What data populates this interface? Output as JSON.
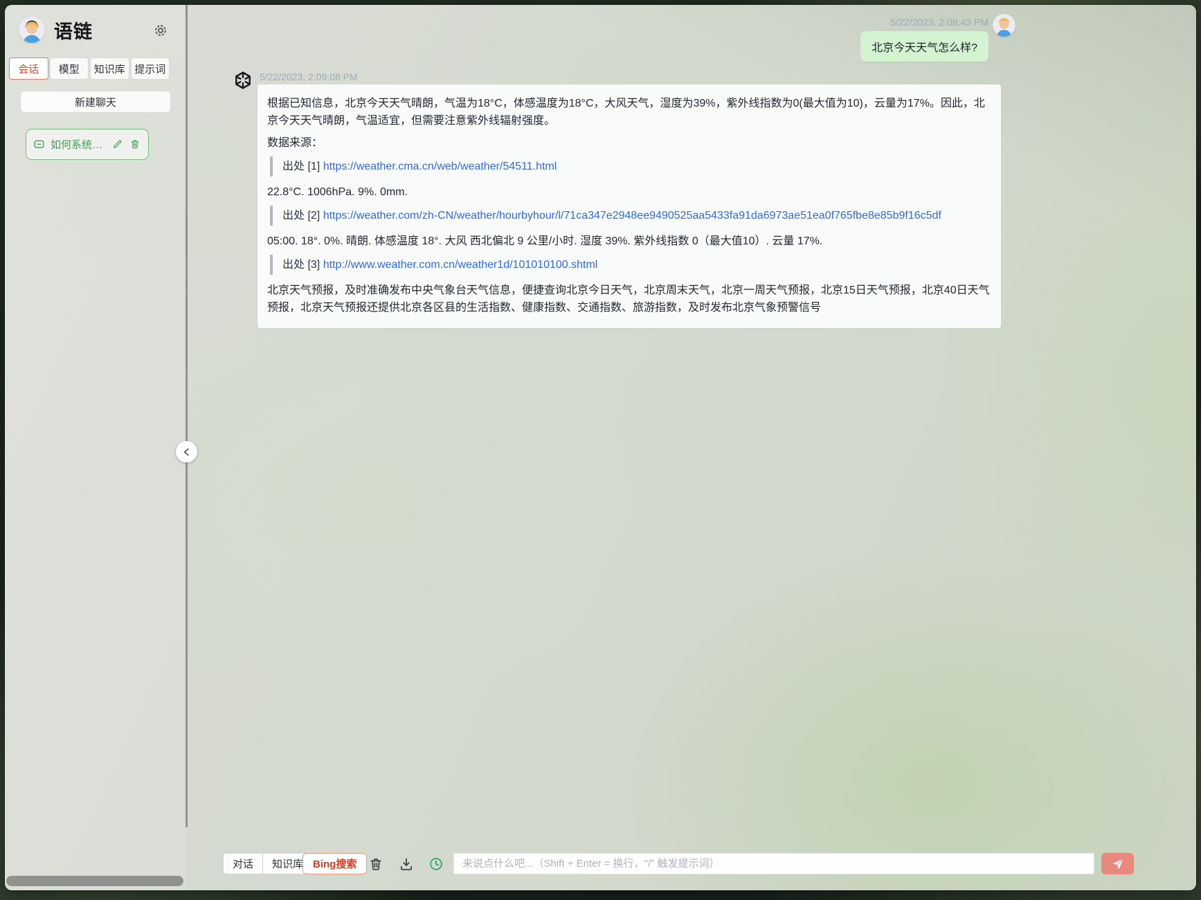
{
  "app": {
    "title": "语链"
  },
  "sidebar": {
    "tabs": [
      {
        "label": "会话",
        "active": true
      },
      {
        "label": "模型",
        "active": false
      },
      {
        "label": "知识库",
        "active": false
      },
      {
        "label": "提示词",
        "active": false
      }
    ],
    "new_chat_label": "新建聊天",
    "chats": [
      {
        "title": "如何系统、高效..."
      }
    ]
  },
  "chat": {
    "user_message": {
      "timestamp": "5/22/2023, 2:08:43 PM",
      "text": "北京今天天气怎么样?"
    },
    "assistant_message": {
      "timestamp": "5/22/2023, 2:09:08 PM",
      "blocks": [
        {
          "type": "p",
          "text": "根据已知信息，北京今天天气晴朗，气温为18°C，体感温度为18°C，大风天气，湿度为39%，紫外线指数为0(最大值为10)，云量为17%。因此，北京今天天气晴朗，气温适宜，但需要注意紫外线辐射强度。"
        },
        {
          "type": "p",
          "text": "数据来源："
        },
        {
          "type": "quote",
          "prefix": "出处 [1] ",
          "link": "https://weather.cma.cn/web/weather/54511.html"
        },
        {
          "type": "p",
          "text": "22.8°C. 1006hPa. 9%. 0mm."
        },
        {
          "type": "quote",
          "prefix": "出处 [2] ",
          "link": "https://weather.com/zh-CN/weather/hourbyhour/l/71ca347e2948ee9490525aa5433fa91da6973ae51ea0f765fbe8e85b9f16c5df"
        },
        {
          "type": "p",
          "text": "05:00. 18°. 0%. 晴朗. 体感温度 18°. 大风 西北偏北 9 公里/小时. 湿度 39%. 紫外线指数 0（最大值10）. 云量 17%."
        },
        {
          "type": "quote",
          "prefix": "出处 [3] ",
          "link": "http://www.weather.com.cn/weather1d/101010100.shtml"
        },
        {
          "type": "p",
          "text": "北京天气预报，及时准确发布中央气象台天气信息，便捷查询北京今日天气，北京周末天气，北京一周天气预报，北京15日天气预报，北京40日天气预报，北京天气预报还提供北京各区县的生活指数、健康指数、交通指数、旅游指数，及时发布北京气象预警信号"
        }
      ]
    }
  },
  "composer": {
    "mode_tabs": [
      {
        "label": "对话"
      },
      {
        "label": "知识库"
      }
    ],
    "bing_label": "Bing搜索",
    "placeholder": "来说点什么吧...（Shift + Enter = 换行，\"/\" 触发提示词）"
  },
  "colors": {
    "accent_red": "#e5472d",
    "chat_green": "#3f9e54",
    "link_blue": "#2f6ae8",
    "send_salmon": "#e8897e",
    "user_bubble_green": "#d4f3d0"
  }
}
